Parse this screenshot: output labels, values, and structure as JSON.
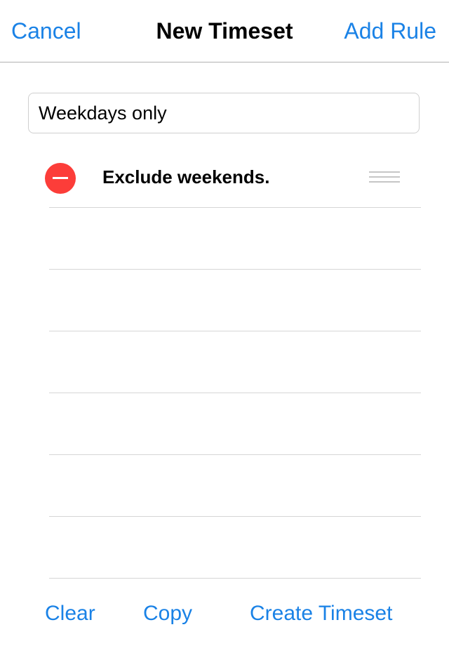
{
  "navbar": {
    "cancel_label": "Cancel",
    "title": "New Timeset",
    "add_rule_label": "Add Rule"
  },
  "timeset_name": {
    "value": "Weekdays only"
  },
  "rules": [
    {
      "label": "Exclude weekends."
    }
  ],
  "toolbar": {
    "clear_label": "Clear",
    "copy_label": "Copy",
    "create_label": "Create Timeset"
  },
  "colors": {
    "accent": "#1a82e6",
    "delete": "#fc3d39"
  },
  "icons": {
    "delete": "minus-circle-icon",
    "reorder": "drag-handle-icon"
  }
}
